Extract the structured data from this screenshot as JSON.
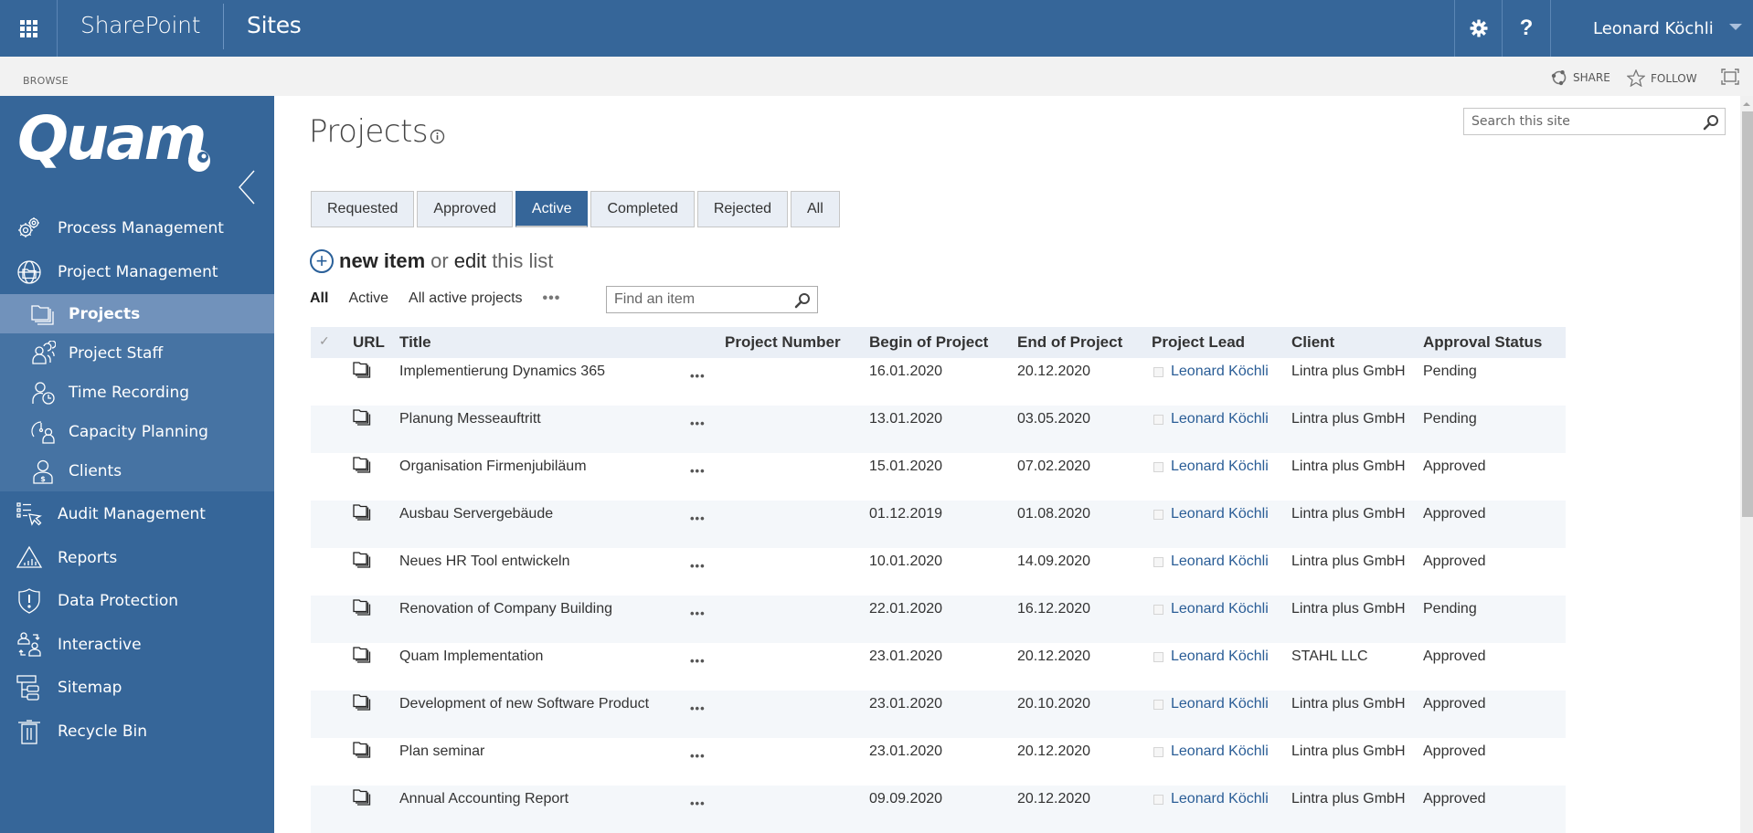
{
  "suitebar": {
    "app_name": "SharePoint",
    "section": "Sites",
    "user_name": "Leonard Köchli",
    "help_label": "?"
  },
  "ribbon": {
    "browse_label": "BROWSE",
    "share_label": "SHARE",
    "follow_label": "FOLLOW"
  },
  "sidebar": {
    "logo_text": "Quam",
    "items": [
      {
        "label": "Process Management",
        "icon": "gears-icon"
      },
      {
        "label": "Project Management",
        "icon": "globe-folder-icon"
      },
      {
        "label": "Audit Management",
        "icon": "checklist-cursor-icon"
      },
      {
        "label": "Reports",
        "icon": "report-chart-icon"
      },
      {
        "label": "Data Protection",
        "icon": "shield-alert-icon"
      },
      {
        "label": "Interactive",
        "icon": "people-exchange-icon"
      },
      {
        "label": "Sitemap",
        "icon": "sitemap-icon"
      },
      {
        "label": "Recycle Bin",
        "icon": "trash-icon"
      }
    ],
    "sub_items": [
      {
        "label": "Projects",
        "icon": "folders-icon",
        "selected": true
      },
      {
        "label": "Project Staff",
        "icon": "people-group-icon",
        "selected": false
      },
      {
        "label": "Time Recording",
        "icon": "person-clock-icon",
        "selected": false
      },
      {
        "label": "Capacity Planning",
        "icon": "gauge-person-icon",
        "selected": false
      },
      {
        "label": "Clients",
        "icon": "person-money-icon",
        "selected": false
      }
    ]
  },
  "main": {
    "title": "Projects",
    "site_search_placeholder": "Search this site",
    "tabs": [
      {
        "label": "Requested",
        "active": false
      },
      {
        "label": "Approved",
        "active": false
      },
      {
        "label": "Active",
        "active": true
      },
      {
        "label": "Completed",
        "active": false
      },
      {
        "label": "Rejected",
        "active": false
      },
      {
        "label": "All",
        "active": false
      }
    ],
    "new_item": {
      "new_label": "new item",
      "or_label": "or",
      "edit_label": "edit",
      "list_label": "this list"
    },
    "views": {
      "items": [
        "All",
        "Active",
        "All active projects"
      ],
      "selected": "All",
      "more_label": "•••",
      "find_placeholder": "Find an item"
    }
  },
  "table": {
    "columns": [
      "URL",
      "Title",
      "Project Number",
      "Begin of Project",
      "End of Project",
      "Project Lead",
      "Client",
      "Approval Status"
    ],
    "check_glyph": "✓",
    "ellipsis": "•••",
    "rows": [
      {
        "title": "Implementierung Dynamics 365",
        "project_number": "",
        "begin": "16.01.2020",
        "end": "20.12.2020",
        "lead": "Leonard Köchli",
        "client": "Lintra plus GmbH",
        "status": "Pending"
      },
      {
        "title": "Planung Messeauftritt",
        "project_number": "",
        "begin": "13.01.2020",
        "end": "03.05.2020",
        "lead": "Leonard Köchli",
        "client": "Lintra plus GmbH",
        "status": "Pending"
      },
      {
        "title": "Organisation Firmenjubiläum",
        "project_number": "",
        "begin": "15.01.2020",
        "end": "07.02.2020",
        "lead": "Leonard Köchli",
        "client": "Lintra plus GmbH",
        "status": "Approved"
      },
      {
        "title": "Ausbau Servergebäude",
        "project_number": "",
        "begin": "01.12.2019",
        "end": "01.08.2020",
        "lead": "Leonard Köchli",
        "client": "Lintra plus GmbH",
        "status": "Approved"
      },
      {
        "title": "Neues HR Tool entwickeln",
        "project_number": "",
        "begin": "10.01.2020",
        "end": "14.09.2020",
        "lead": "Leonard Köchli",
        "client": "Lintra plus GmbH",
        "status": "Approved"
      },
      {
        "title": "Renovation of Company Building",
        "project_number": "",
        "begin": "22.01.2020",
        "end": "16.12.2020",
        "lead": "Leonard Köchli",
        "client": "Lintra plus GmbH",
        "status": "Pending"
      },
      {
        "title": "Quam Implementation",
        "project_number": "",
        "begin": "23.01.2020",
        "end": "20.12.2020",
        "lead": "Leonard Köchli",
        "client": "STAHL LLC",
        "status": "Approved"
      },
      {
        "title": "Development of new Software Product",
        "project_number": "",
        "begin": "23.01.2020",
        "end": "20.10.2020",
        "lead": "Leonard Köchli",
        "client": "Lintra plus GmbH",
        "status": "Approved"
      },
      {
        "title": "Plan seminar",
        "project_number": "",
        "begin": "23.01.2020",
        "end": "20.12.2020",
        "lead": "Leonard Köchli",
        "client": "Lintra plus GmbH",
        "status": "Approved"
      },
      {
        "title": "Annual Accounting Report",
        "project_number": "",
        "begin": "09.09.2020",
        "end": "20.12.2020",
        "lead": "Leonard Köchli",
        "client": "Lintra plus GmbH",
        "status": "Approved"
      }
    ]
  },
  "colors": {
    "brand": "#366699",
    "subnav": "#4673a3",
    "selected_nav": "#7192bb",
    "link": "#2a5d96"
  }
}
